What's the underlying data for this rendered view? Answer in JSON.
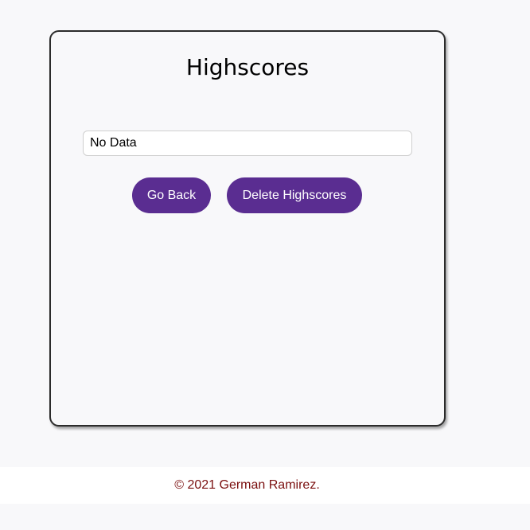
{
  "page": {
    "title": "Highscores",
    "scores_text": "No Data",
    "buttons": {
      "go_back_label": "Go Back",
      "delete_label": "Delete Highscores"
    },
    "footer": {
      "copyright": "© 2021 German Ramirez."
    }
  },
  "colors": {
    "accent": "#5a2d91",
    "footer_text": "#7a0e0e",
    "background": "#f8f8fa"
  }
}
